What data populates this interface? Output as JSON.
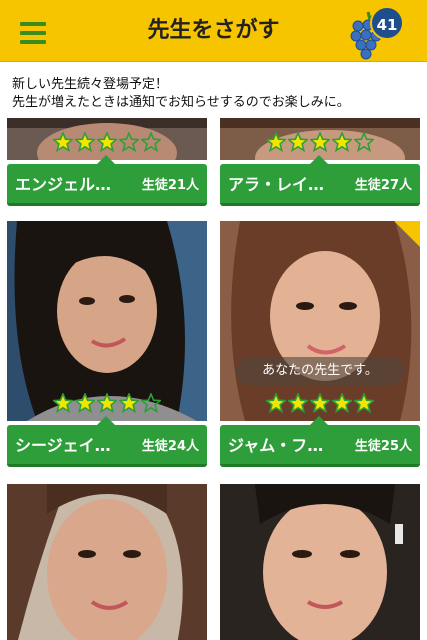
{
  "header": {
    "title": "先生をさがす",
    "badge_count": "41",
    "brand_color": "#f7c500",
    "menu_icon": "hamburger-icon",
    "grape_icon": "grape-icon"
  },
  "notice": {
    "line1": "新しい先生続々登場予定！",
    "line2": "先生が増えたときは通知でお知らせするのでお楽しみに。"
  },
  "teachers": [
    {
      "name": "エンジェル…",
      "students": "生徒21人",
      "rating": 3
    },
    {
      "name": "アラ・レイ…",
      "students": "生徒27人",
      "rating": 4
    },
    {
      "name": "シージェイ…",
      "students": "生徒24人",
      "rating": 4
    },
    {
      "name": "ジャム・フ…",
      "students": "生徒25人",
      "rating": 5,
      "tag": "あなたの先生です。"
    },
    {
      "name": "",
      "students": "",
      "rating": 0
    },
    {
      "name": "",
      "students": "",
      "rating": 0
    }
  ],
  "colors": {
    "accent_green": "#2e9e3a",
    "star_yellow": "#f2e600"
  }
}
